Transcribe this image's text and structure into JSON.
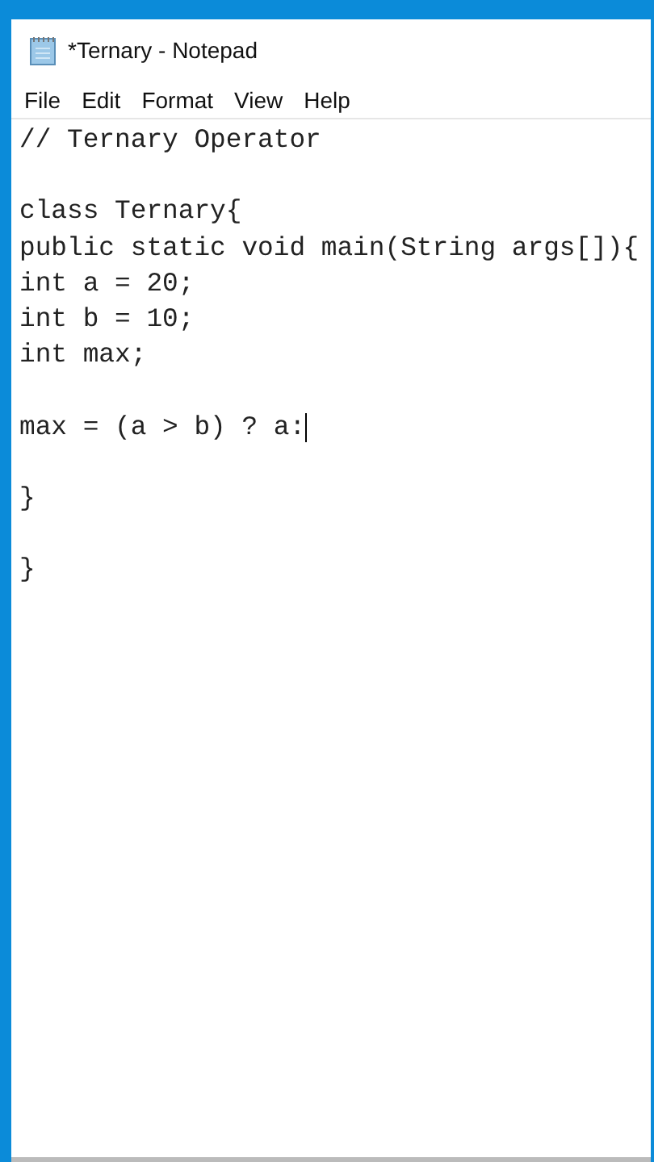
{
  "window": {
    "title": "*Ternary - Notepad"
  },
  "menu": [
    "File",
    "Edit",
    "Format",
    "View",
    "Help"
  ],
  "editor": {
    "lines": [
      {
        "text": "// Ternary Operator",
        "blank_before": false,
        "caret": false
      },
      {
        "text": "class Ternary{",
        "blank_before": true,
        "caret": false
      },
      {
        "text": "public static void main(String args[]){",
        "blank_before": false,
        "caret": false
      },
      {
        "text": "int a = 20;",
        "blank_before": false,
        "caret": false
      },
      {
        "text": "int b = 10;",
        "blank_before": false,
        "caret": false
      },
      {
        "text": "int max;",
        "blank_before": false,
        "caret": false
      },
      {
        "text": "max = (a > b) ? a:",
        "blank_before": true,
        "caret": true
      },
      {
        "text": "}",
        "blank_before": true,
        "caret": false
      },
      {
        "text": "}",
        "blank_before": true,
        "caret": false
      }
    ]
  }
}
